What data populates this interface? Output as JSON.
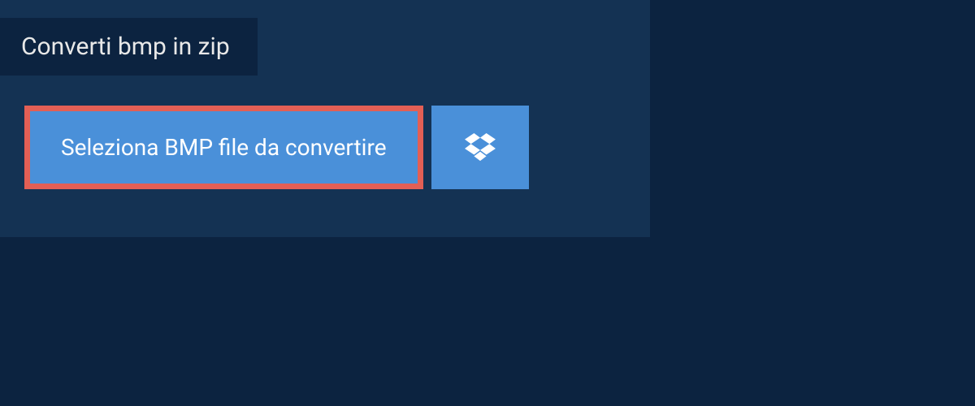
{
  "tab": {
    "title": "Converti bmp in zip"
  },
  "actions": {
    "select_label": "Seleziona BMP file da convertire"
  },
  "colors": {
    "background": "#0c2340",
    "panel": "#143253",
    "button": "#4a90d9",
    "highlight_border": "#e35f55"
  }
}
